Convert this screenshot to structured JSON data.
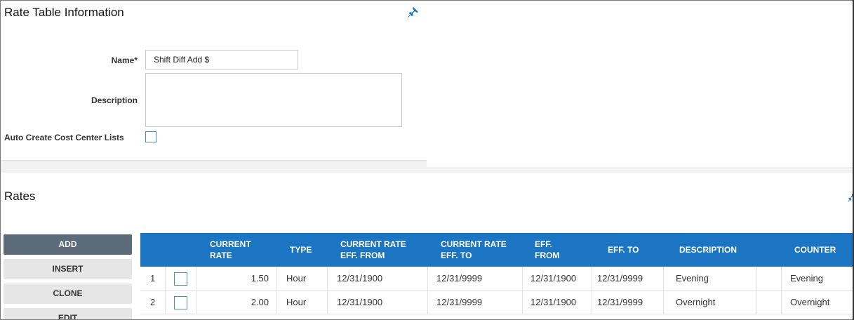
{
  "info_panel": {
    "title": "Rate Table Information",
    "pin_icon": "pin-icon",
    "name_label": "Name*",
    "name_value": "Shift Diff Add $",
    "description_label": "Description",
    "description_value": "",
    "auto_create_label": "Auto Create Cost Center Lists",
    "auto_create_checked": false
  },
  "rates_panel": {
    "title": "Rates",
    "buttons": {
      "add": "ADD",
      "insert": "INSERT",
      "clone": "CLONE",
      "edit": "EDIT"
    },
    "columns": {
      "current_rate": "CURRENT RATE",
      "type": "TYPE",
      "current_rate_eff_from": "CURRENT RATE EFF. FROM",
      "current_rate_eff_to": "CURRENT RATE EFF. TO",
      "eff_from": "EFF. FROM",
      "eff_to": "EFF. TO",
      "description": "DESCRIPTION",
      "counter": "COUNTER"
    },
    "rows": [
      {
        "index": "1",
        "checked": false,
        "current_rate": "1.50",
        "type": "Hour",
        "current_rate_eff_from": "12/31/1900",
        "current_rate_eff_to": "12/31/9999",
        "eff_from": "12/31/1900",
        "eff_to": "12/31/9999",
        "description": "Evening",
        "counter": "Evening"
      },
      {
        "index": "2",
        "checked": false,
        "current_rate": "2.00",
        "type": "Hour",
        "current_rate_eff_from": "12/31/1900",
        "current_rate_eff_to": "12/31/9999",
        "eff_from": "12/31/1900",
        "eff_to": "12/31/9999",
        "description": "Overnight",
        "counter": "Overnight"
      }
    ]
  },
  "colors": {
    "header_blue": "#1b75c2",
    "add_button": "#5b6b7a",
    "checkbox_border": "#4a90c8"
  }
}
